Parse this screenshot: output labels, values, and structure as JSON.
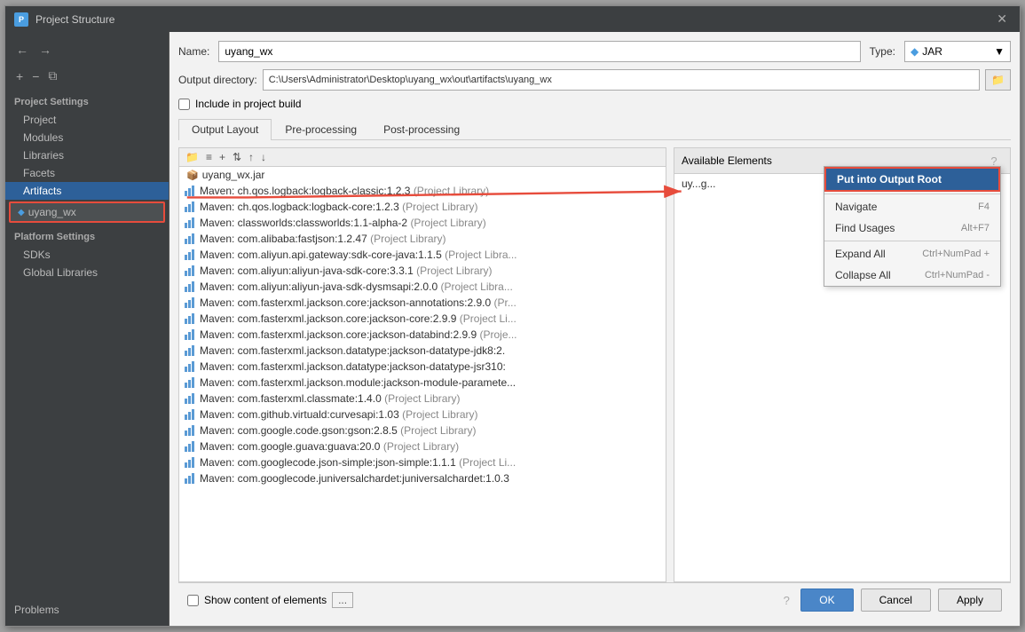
{
  "dialog": {
    "title": "Project Structure",
    "close_label": "✕"
  },
  "sidebar": {
    "nav_back": "←",
    "nav_forward": "→",
    "add_icon": "+",
    "remove_icon": "−",
    "copy_icon": "⧉",
    "project_settings_label": "Project Settings",
    "items": [
      {
        "id": "project",
        "label": "Project"
      },
      {
        "id": "modules",
        "label": "Modules"
      },
      {
        "id": "libraries",
        "label": "Libraries"
      },
      {
        "id": "facets",
        "label": "Facets"
      },
      {
        "id": "artifacts",
        "label": "Artifacts",
        "selected": true
      }
    ],
    "artifact_item": "uyang_wx",
    "platform_label": "Platform Settings",
    "platform_items": [
      {
        "id": "sdks",
        "label": "SDKs"
      },
      {
        "id": "global-libraries",
        "label": "Global Libraries"
      }
    ],
    "problems_label": "Problems"
  },
  "main": {
    "name_label": "Name:",
    "name_value": "uyang_wx",
    "type_label": "Type:",
    "type_icon": "◆",
    "type_value": "JAR",
    "type_arrow": "▼",
    "output_dir_label": "Output directory:",
    "output_dir_value": "C:\\Users\\Administrator\\Desktop\\uyang_wx\\out\\artifacts\\uyang_wx",
    "browse_icon": "📁",
    "include_checkbox_label": "Include in project build",
    "tabs": [
      {
        "id": "output-layout",
        "label": "Output Layout",
        "active": true
      },
      {
        "id": "pre-processing",
        "label": "Pre-processing"
      },
      {
        "id": "post-processing",
        "label": "Post-processing"
      }
    ],
    "left_panel": {
      "toolbar_icons": [
        "+",
        "−",
        "↑",
        "↓",
        "⋯"
      ],
      "jar_item": "uyang_wx.jar",
      "maven_items": [
        {
          "text": "Maven: ch.qos.logback:logback-classic:1.2.3",
          "tag": "(Project Library)"
        },
        {
          "text": "Maven: ch.qos.logback:logback-core:1.2.3",
          "tag": "(Project Library)"
        },
        {
          "text": "Maven: classworlds:classworlds:1.1-alpha-2",
          "tag": "(Project Library)"
        },
        {
          "text": "Maven: com.alibaba:fastjson:1.2.47",
          "tag": "(Project Library)"
        },
        {
          "text": "Maven: com.aliyun.api.gateway:sdk-core-java:1.1.5",
          "tag": "(Project Libra..."
        },
        {
          "text": "Maven: com.aliyun:aliyun-java-sdk-core:3.3.1",
          "tag": "(Project Library)"
        },
        {
          "text": "Maven: com.aliyun:aliyun-java-sdk-dysmsapi:2.0.0",
          "tag": "(Project Libra..."
        },
        {
          "text": "Maven: com.fasterxml.jackson.core:jackson-annotations:2.9.0",
          "tag": "(Pr..."
        },
        {
          "text": "Maven: com.fasterxml.jackson.core:jackson-core:2.9.9",
          "tag": "(Project Li..."
        },
        {
          "text": "Maven: com.fasterxml.jackson.core:jackson-databind:2.9.9",
          "tag": "(Proje..."
        },
        {
          "text": "Maven: com.fasterxml.jackson.datatype:jackson-datatype-jdk8:2.",
          "tag": ""
        },
        {
          "text": "Maven: com.fasterxml.jackson.datatype:jackson-datatype-jsr310:",
          "tag": ""
        },
        {
          "text": "Maven: com.fasterxml.jackson.module:jackson-module-paramete...",
          "tag": ""
        },
        {
          "text": "Maven: com.fasterxml.classmate:1.4.0",
          "tag": "(Project Library)"
        },
        {
          "text": "Maven: com.github.virtuald:curvesapi:1.03",
          "tag": "(Project Library)"
        },
        {
          "text": "Maven: com.google.code.gson:gson:2.8.5",
          "tag": "(Project Library)"
        },
        {
          "text": "Maven: com.google.guava:guava:20.0",
          "tag": "(Project Library)"
        },
        {
          "text": "Maven: com.googlecode.json-simple:json-simple:1.1.1",
          "tag": "(Project Li..."
        },
        {
          "text": "Maven: com.googlecode.juniversalchardet:juniversalchardet:1.0.3",
          "tag": ""
        }
      ]
    },
    "right_panel": {
      "available_label": "Available Elements",
      "help_icon": "?",
      "truncated_text": "uy...g..."
    },
    "context_menu": {
      "items": [
        {
          "id": "put-into-output-root",
          "label": "Put into Output Root",
          "shortcut": "",
          "highlighted": true
        },
        {
          "id": "navigate",
          "label": "Navigate",
          "shortcut": "F4"
        },
        {
          "id": "find-usages",
          "label": "Find Usages",
          "shortcut": "Alt+F7"
        },
        {
          "id": "expand-all",
          "label": "Expand All",
          "shortcut": "Ctrl+NumPad +"
        },
        {
          "id": "collapse-all",
          "label": "Collapse All",
          "shortcut": "Ctrl+NumPad -"
        }
      ]
    },
    "bottom": {
      "show_content_label": "Show content of elements",
      "more_btn": "...",
      "ok_btn": "OK",
      "cancel_btn": "Cancel",
      "apply_btn": "Apply"
    }
  },
  "colors": {
    "selected_bg": "#2d6099",
    "accent_red": "#e74c3c",
    "type_diamond": "#4a9de0"
  }
}
